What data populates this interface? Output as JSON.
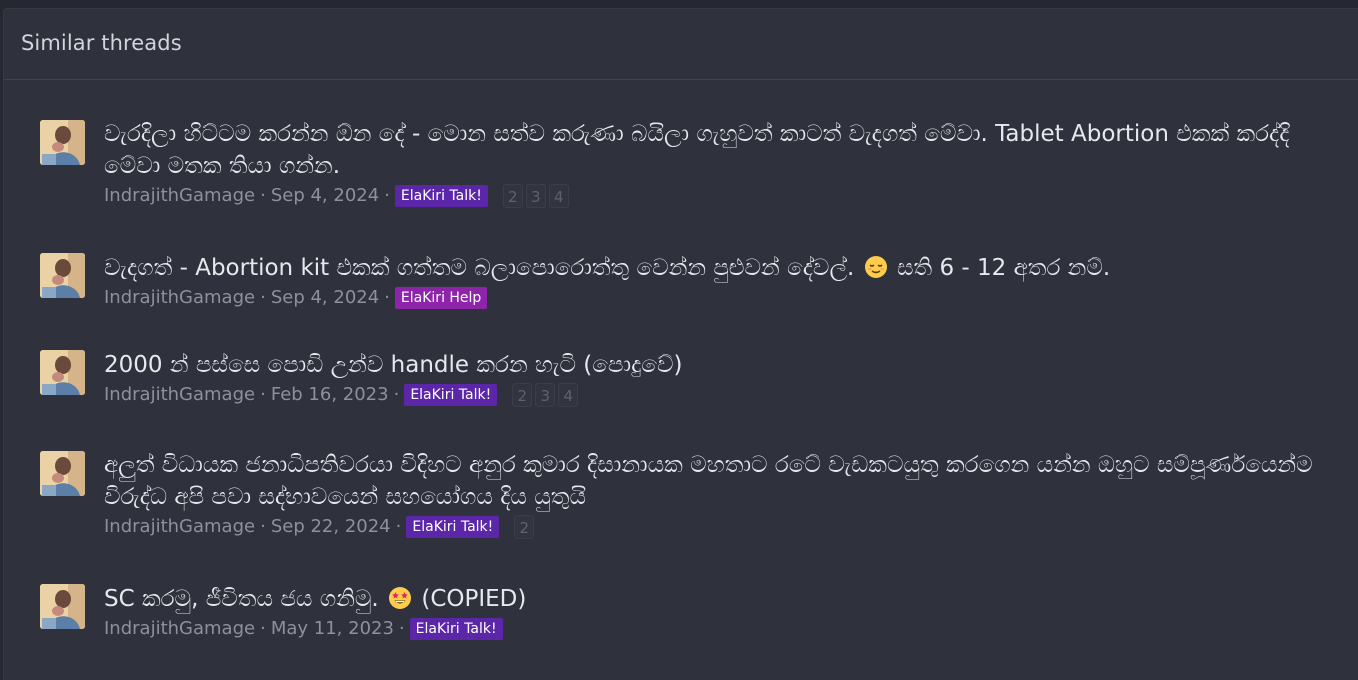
{
  "section": {
    "title": "Similar threads"
  },
  "colors": {
    "talk_prefix": "#5b26a8",
    "help_prefix": "#8e24aa"
  },
  "threads": [
    {
      "title": "වැරදිලා හිට්ටම කරන්න ඕන දේ - මොන සත්ව කරුණා බයිලා ගැහුවත් කාටත් වැදගත් මේවා. Tablet Abortion එකක් කරද්දි මේවා මතක තියා ගන්න.",
      "author": "IndrajithGamage",
      "date": "Sep 4, 2024",
      "prefix": "ElaKiri Talk!",
      "pages": [
        "2",
        "3",
        "4"
      ]
    },
    {
      "title_before": "වැදගත් - Abortion kit එකක් ගත්තම බලාපොරොත්තු වෙන්න පුළුවන් දේවල්.",
      "title_emoji": "relieved-face-emoji",
      "title_after": "සති 6 - 12 අතර නම්.",
      "author": "IndrajithGamage",
      "date": "Sep 4, 2024",
      "prefix": "ElaKiri Help",
      "pages": []
    },
    {
      "title": "2000 න් පස්සෙ පොඩි උන්ව handle කරන හැටි (පොදුවේ)",
      "author": "IndrajithGamage",
      "date": "Feb 16, 2023",
      "prefix": "ElaKiri Talk!",
      "pages": [
        "2",
        "3",
        "4"
      ]
    },
    {
      "title": "අලුත් විධායක ජනාධිපතිවරයා විදිහට අනුර කුමාර දිසානායක මහතාට රටේ වැඩකටයුතු කරගෙන යන්න ඔහුට සම්පූර්ණයෙන්ම විරුද්ධ අපි පවා සද්භාවයෙන් සහයෝගය දිය යුතුයි",
      "author": "IndrajithGamage",
      "date": "Sep 22, 2024",
      "prefix": "ElaKiri Talk!",
      "pages": [
        "2"
      ]
    },
    {
      "title_before": "SC කරමු, ජීවිතය ජය ගනිමු.",
      "title_emoji": "star-struck-emoji",
      "title_after": "(COPIED)",
      "author": "IndrajithGamage",
      "date": "May 11, 2023",
      "prefix": "ElaKiri Talk!",
      "pages": []
    }
  ]
}
